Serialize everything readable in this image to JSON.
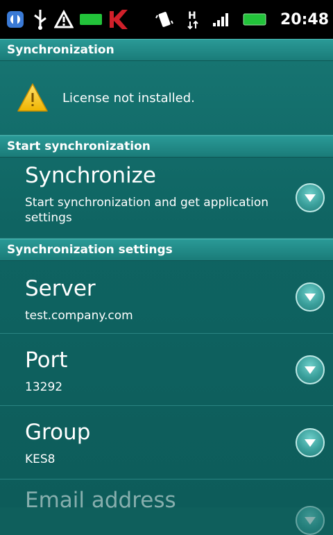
{
  "status_bar": {
    "time": "20:48",
    "network_type": "H",
    "icons": [
      "android-debug-icon",
      "usb-icon",
      "warning-icon",
      "battery-green-icon",
      "kaspersky-icon",
      "vibrate-icon",
      "network-h-icon",
      "signal-icon",
      "battery-icon"
    ]
  },
  "sync_section": {
    "header": "Synchronization",
    "license_message": "License not installed."
  },
  "start_section": {
    "header": "Start synchronization",
    "item": {
      "title": "Synchronize",
      "subtitle": "Start synchronization and get application settings"
    }
  },
  "settings_section": {
    "header": "Synchronization settings",
    "items": [
      {
        "title": "Server",
        "value": "test.company.com"
      },
      {
        "title": "Port",
        "value": "13292"
      },
      {
        "title": "Group",
        "value": "KES8"
      },
      {
        "title": "Email address",
        "value": ""
      }
    ]
  },
  "colors": {
    "background": "#0f5f5c",
    "header": "#1a7c79",
    "accent": "#3a9f9b"
  }
}
